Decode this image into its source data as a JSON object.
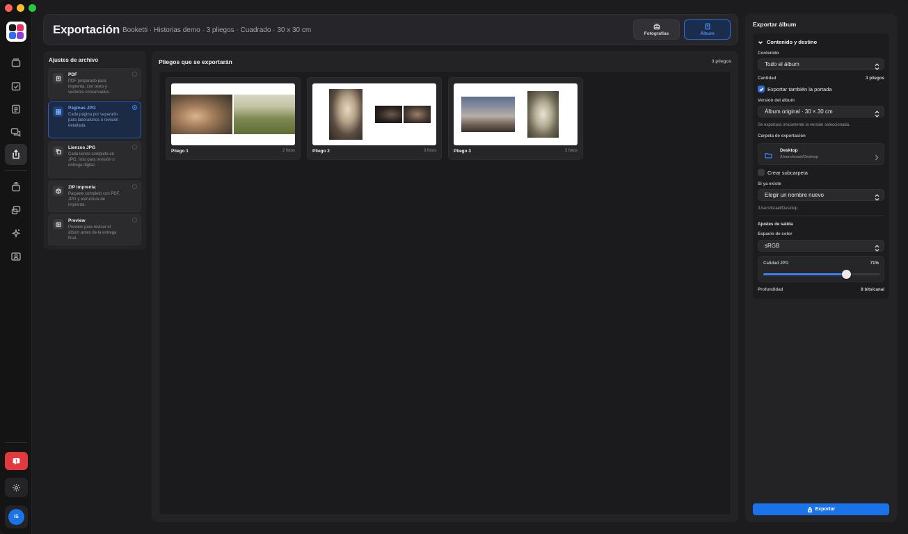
{
  "app": {
    "logo_colors": [
      "#e8345a",
      "#8b3fd9",
      "#2b6ff0",
      "#1c1c1e"
    ]
  },
  "rail": {
    "items": [
      {
        "icon": "albums-icon",
        "active": false
      },
      {
        "icon": "checklist-icon",
        "active": false
      },
      {
        "icon": "book-icon",
        "active": false
      },
      {
        "icon": "chat-icon",
        "active": false
      },
      {
        "icon": "share-icon",
        "active": true
      },
      {
        "icon": "stack-icon",
        "active": false
      },
      {
        "icon": "layers-icon",
        "active": false
      },
      {
        "icon": "sparkle-icon",
        "active": false
      },
      {
        "icon": "contact-card-icon",
        "active": false
      }
    ],
    "avatar_initials": "IS",
    "alert_color": "#e0393e",
    "avatar_color": "#1a73e8"
  },
  "header": {
    "title": "Exportación",
    "subtitle": "Booketti · Historias demo · 3 pliegos · Cuadrado · 30 x 30 cm",
    "tab_photos": "Fotografías",
    "tab_album": "Álbum"
  },
  "file_settings": {
    "title": "Ajustes de archivo",
    "formats": [
      {
        "name": "PDF",
        "desc": "PDF preparado para imprenta, con texto y vectores conservados.",
        "icon": "document-icon",
        "selected": false
      },
      {
        "name": "Páginas JPG",
        "desc": "Cada página por separado para laboratorios o revisión detallada.",
        "icon": "grid-icon",
        "selected": true
      },
      {
        "name": "Lienzos JPG",
        "desc": "Cada lienzo completo en JPG, listo para revisión o entrega digital.",
        "icon": "copy-icon",
        "selected": false
      },
      {
        "name": "ZIP imprenta",
        "desc": "Paquete completo con PDF, JPG y estructura de imprenta.",
        "icon": "package-icon",
        "selected": false
      },
      {
        "name": "Preview",
        "desc": "Preview para revisar el álbum antes de la entrega final.",
        "icon": "preview-icon",
        "selected": false
      }
    ]
  },
  "spreads": {
    "title": "Pliegos que se exportarán",
    "count": "3 pliegos",
    "items": [
      {
        "name": "Pliego 1",
        "photos": "2 fotos"
      },
      {
        "name": "Pliego 2",
        "photos": "3 fotos"
      },
      {
        "name": "Pliego 3",
        "photos": "2 fotos"
      }
    ]
  },
  "export_panel": {
    "title": "Exportar álbum",
    "section": "Contenido y destino",
    "content_label": "Contenido",
    "content_value": "Todo el álbum",
    "quantity_label": "Cantidad",
    "quantity_value": "3 pliegos",
    "cover_label": "Exportar también la portada",
    "cover_checked": true,
    "version_label": "Versión del álbum",
    "version_value": "Álbum original · 30 × 30 cm",
    "version_hint": "Se exportará únicamente la versión seleccionada.",
    "folder_label": "Carpeta de exportación",
    "folder_name": "Desktop",
    "folder_path": "/Users/israel/Desktop",
    "subfolder_label": "Crear subcarpeta",
    "subfolder_checked": false,
    "exists_label": "Si ya existe",
    "exists_value": "Elegir un nombre nuevo",
    "exists_path": "/Users/israel/Desktop",
    "output_label": "Ajustes de salida",
    "colorspace_label": "Espacio de color",
    "colorspace_value": "sRGB",
    "quality_label": "Calidad JPG",
    "quality_value": "71%",
    "quality_fraction": 0.71,
    "depth_label": "Profundidad",
    "depth_value": "8 bits/canal",
    "export_button": "Exportar",
    "accent_color": "#1a73e8"
  }
}
